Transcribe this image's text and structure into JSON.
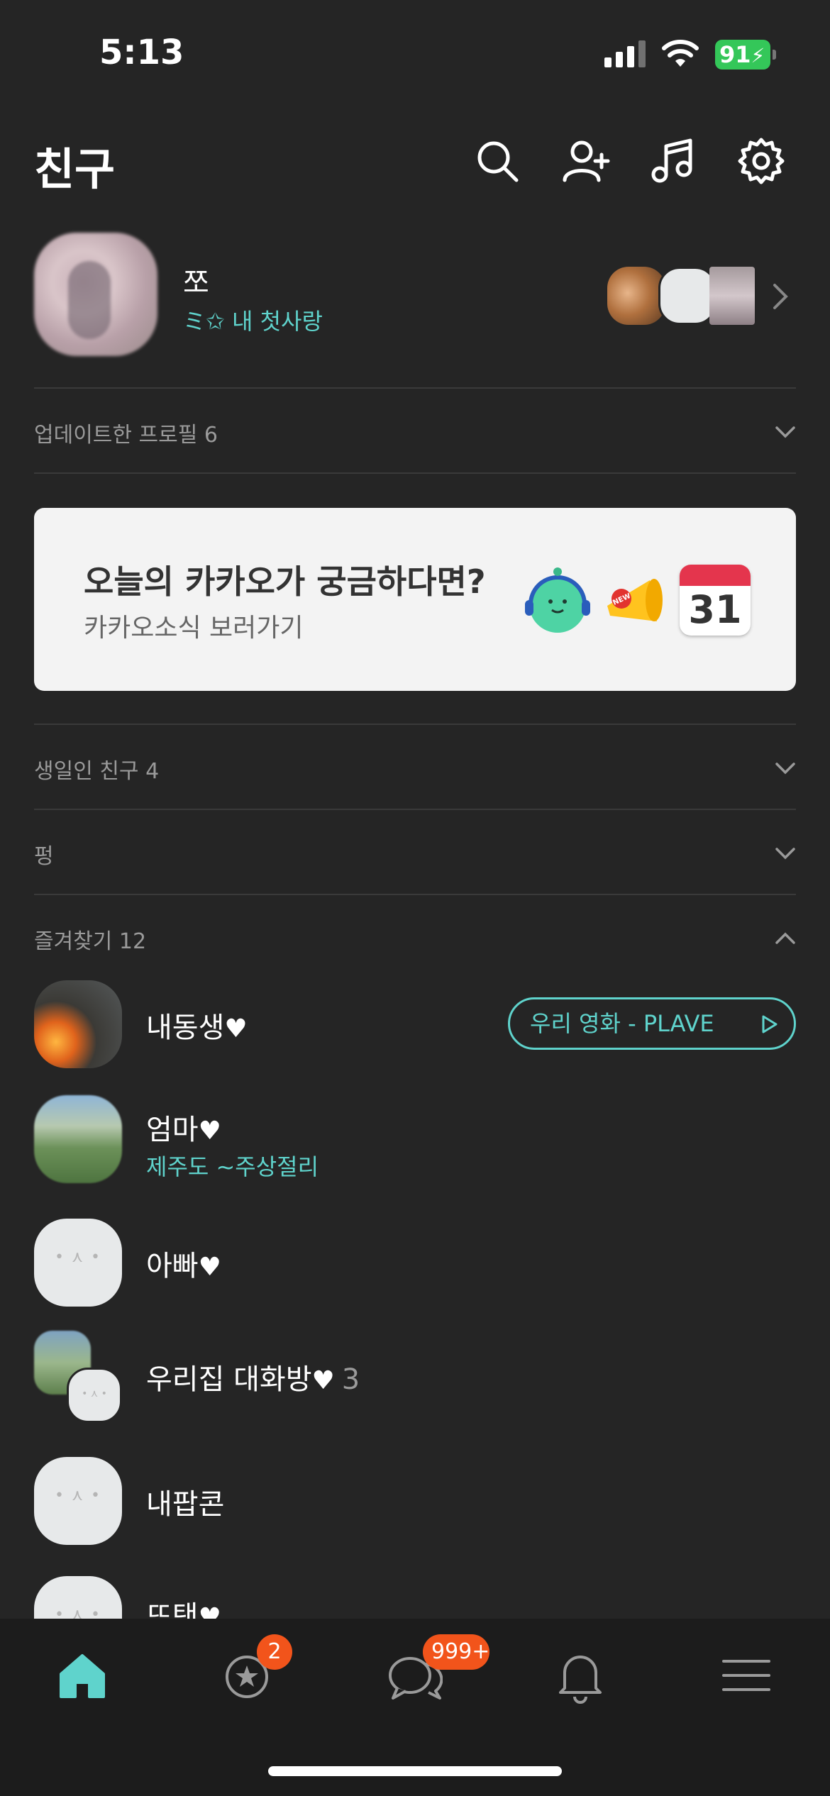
{
  "status_bar": {
    "time": "5:13",
    "battery": "91"
  },
  "header": {
    "title": "친구",
    "icons": [
      "search-icon",
      "add-friend-icon",
      "music-icon",
      "settings-icon"
    ]
  },
  "my_profile": {
    "name": "쪼",
    "status": "ミ✩ 내 첫사랑"
  },
  "sections": {
    "updated_profiles": "업데이트한 프로필 6",
    "birthday_friends": "생일인 친구 4",
    "pung": "펑",
    "favorites": "즐겨찾기 12"
  },
  "banner": {
    "title": "오늘의 카카오가 궁금하다면?",
    "subtitle": "카카오소식 보러가기",
    "calendar_day": "31",
    "new_tag": "NEW"
  },
  "friends": [
    {
      "name": "내동생",
      "heart": "♥",
      "music": "우리 영화 - PLAVE"
    },
    {
      "name": "엄마",
      "heart": "♥",
      "status": "제주도 ~주상절리"
    },
    {
      "name": "아빠",
      "heart": "♥"
    },
    {
      "name": "우리집 대화방",
      "heart": "♥",
      "count": "3"
    },
    {
      "name": "내팝콘"
    },
    {
      "name": "뜨탠",
      "heart": "♥"
    }
  ],
  "tab_bar": {
    "tabs": [
      "home-icon",
      "open-chat-icon",
      "chat-icon",
      "notification-icon",
      "menu-icon"
    ],
    "openchat_badge": "2",
    "chat_badge": "999+"
  },
  "colors": {
    "accent": "#5fd3cc",
    "badge": "#f2541b",
    "background": "#252525"
  }
}
